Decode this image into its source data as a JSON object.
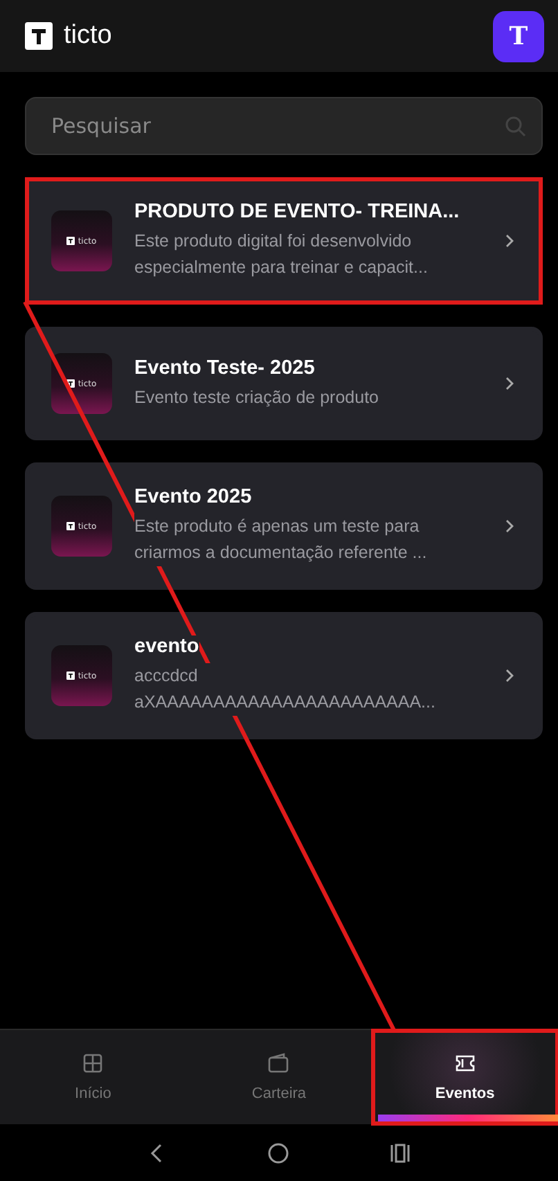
{
  "header": {
    "brand": "ticto",
    "avatar": "T"
  },
  "search": {
    "placeholder": "Pesquisar"
  },
  "products": [
    {
      "thumb_label": "ticto",
      "title": "PRODUTO DE EVENTO- TREINA...",
      "description": "Este produto digital foi desenvolvido especialmente para treinar e capacit...",
      "highlighted": true
    },
    {
      "thumb_label": "ticto",
      "title": "Evento Teste- 2025",
      "description": "Evento teste criação de produto",
      "highlighted": false
    },
    {
      "thumb_label": "ticto",
      "title": "Evento 2025",
      "description": "Este produto é apenas um teste para criarmos a documentação referente ...",
      "highlighted": false
    },
    {
      "thumb_label": "ticto",
      "title": "evento",
      "description": "acccdcd aXAAAAAAAAAAAAAAAAAAAAAAA...",
      "highlighted": false
    }
  ],
  "bottom_nav": [
    {
      "kind": "home",
      "label": "Início",
      "selected": false,
      "highlighted": false
    },
    {
      "kind": "wallet",
      "label": "Carteira",
      "selected": false,
      "highlighted": false
    },
    {
      "kind": "ticket",
      "label": "Eventos",
      "selected": true,
      "highlighted": true
    }
  ],
  "annotation": {
    "connector": true
  }
}
